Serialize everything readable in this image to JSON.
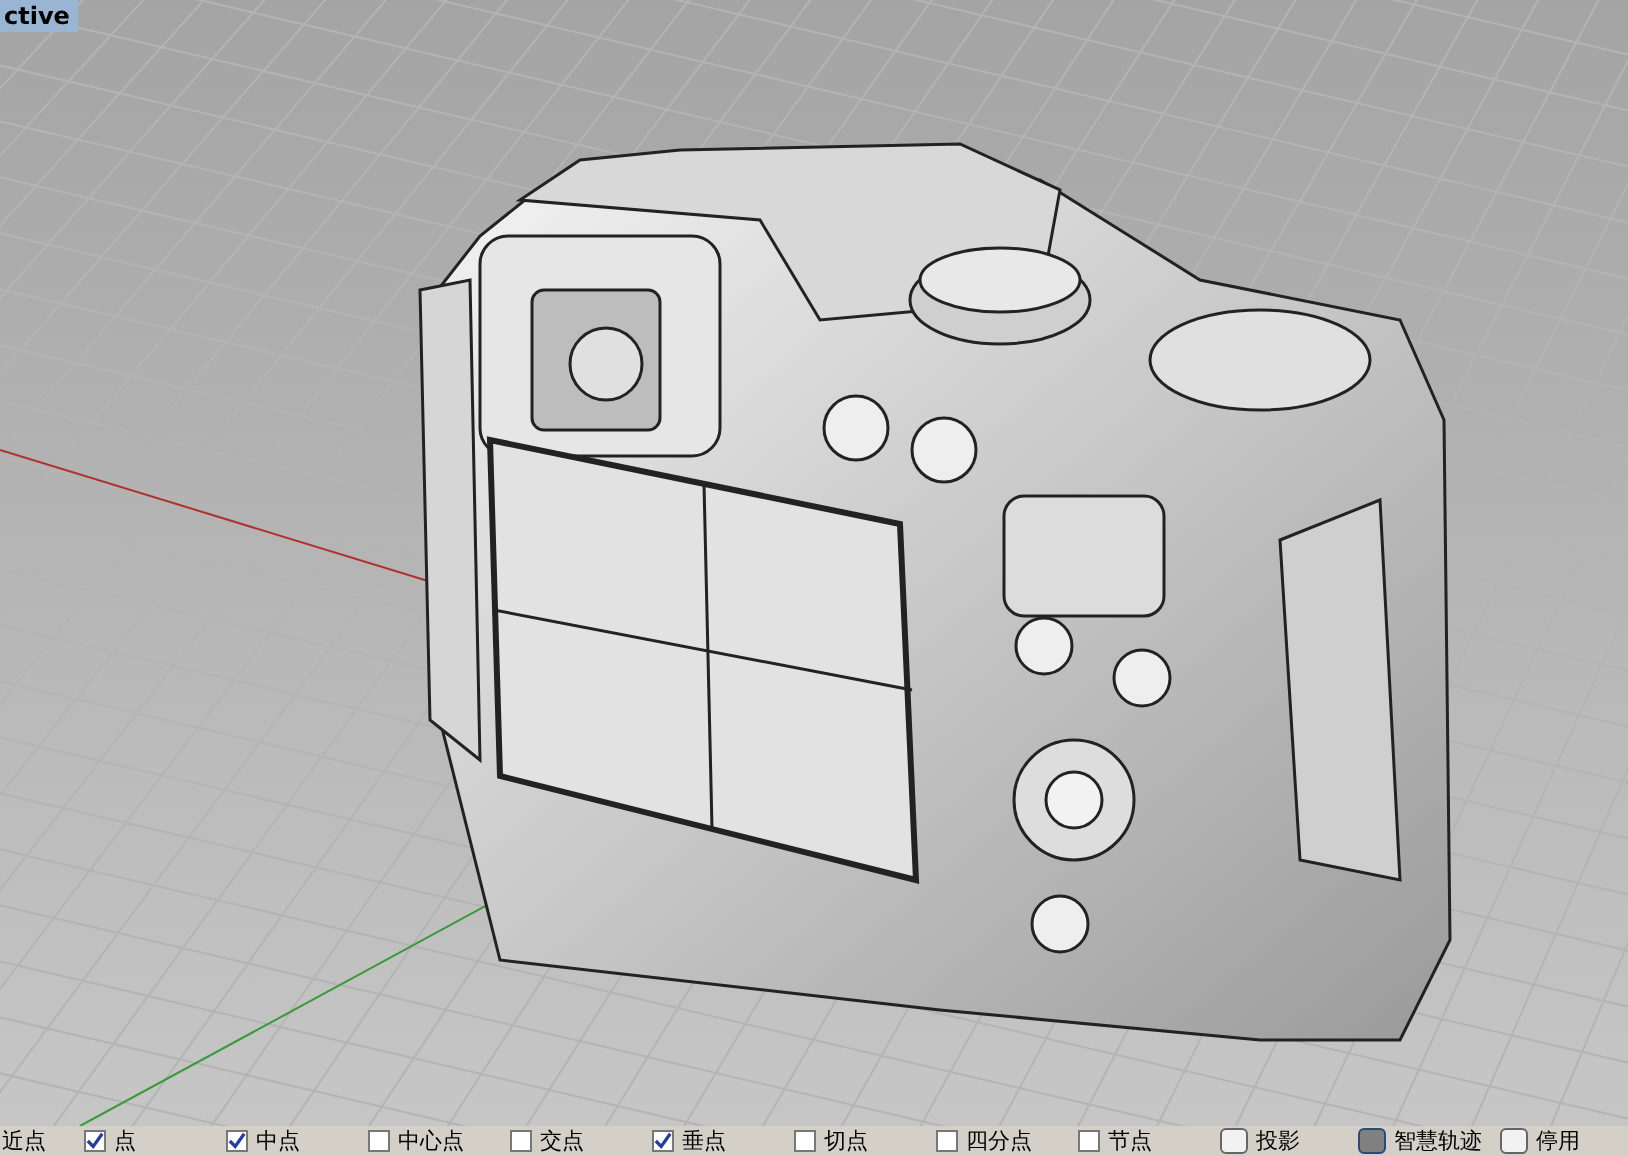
{
  "viewport": {
    "title": "ctive"
  },
  "osnap": {
    "leading_label": "近点",
    "checks": [
      {
        "label": "点",
        "checked": true
      },
      {
        "label": "中点",
        "checked": true
      },
      {
        "label": "中心点",
        "checked": false
      },
      {
        "label": "交点",
        "checked": false
      },
      {
        "label": "垂点",
        "checked": true
      },
      {
        "label": "切点",
        "checked": false
      },
      {
        "label": "四分点",
        "checked": false
      },
      {
        "label": "节点",
        "checked": false
      }
    ],
    "toggles": [
      {
        "label": "投影",
        "on": false
      },
      {
        "label": "智慧轨迹",
        "on": true
      },
      {
        "label": "停用",
        "on": false
      }
    ]
  }
}
